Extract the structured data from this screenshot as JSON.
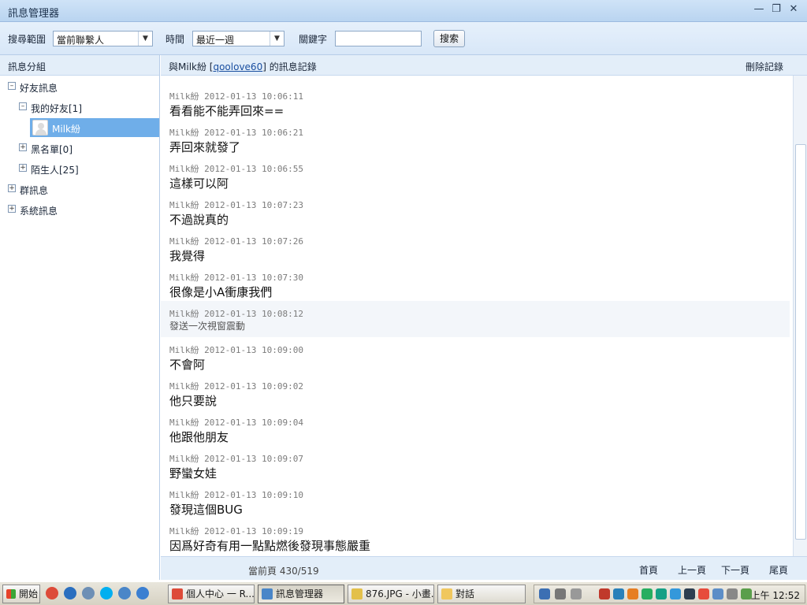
{
  "window": {
    "title": "訊息管理器"
  },
  "toolbar": {
    "scope_label": "搜尋範圍",
    "scope_value": "當前聯繫人",
    "time_label": "時間",
    "time_value": "最近一週",
    "keyword_label": "關鍵字",
    "keyword_value": "",
    "search_button": "搜索"
  },
  "left": {
    "header": "訊息分組",
    "tree": {
      "friend_msgs": "好友訊息",
      "my_friends": "我的好友[1]",
      "contact": "Milk紛",
      "blacklist": "黑名單[0]",
      "strangers": "陌生人[25]",
      "group_msgs": "群訊息",
      "system_msgs": "系統訊息"
    }
  },
  "right": {
    "header_prefix": "與Milk紛 [",
    "header_link": "qoolove60",
    "header_suffix": "] 的訊息記錄",
    "delete": "刪除記錄"
  },
  "messages": [
    {
      "meta": "Milk紛 2012-01-13 10:06:11",
      "text": "看看能不能弄回來=="
    },
    {
      "meta": "Milk紛 2012-01-13 10:06:21",
      "text": "弄回來就發了"
    },
    {
      "meta": "Milk紛 2012-01-13 10:06:55",
      "text": "這樣可以阿"
    },
    {
      "meta": "Milk紛 2012-01-13 10:07:23",
      "text": "不過說真的"
    },
    {
      "meta": "Milk紛 2012-01-13 10:07:26",
      "text": "我覺得"
    },
    {
      "meta": "Milk紛 2012-01-13 10:07:30",
      "text": "很像是小A衝康我們"
    },
    {
      "meta": "Milk紛 2012-01-13 10:08:12",
      "text": "發送一次視窗震動"
    },
    {
      "meta": "Milk紛 2012-01-13 10:09:00",
      "text": "不會阿"
    },
    {
      "meta": "Milk紛 2012-01-13 10:09:02",
      "text": "他只要說"
    },
    {
      "meta": "Milk紛 2012-01-13 10:09:04",
      "text": "他跟他朋友"
    },
    {
      "meta": "Milk紛 2012-01-13 10:09:07",
      "text": "野蠻女娃"
    },
    {
      "meta": "Milk紛 2012-01-13 10:09:10",
      "text": "發現這個BUG"
    },
    {
      "meta": "Milk紛 2012-01-13 10:09:19",
      "text": "因爲好奇有用一點點燃後發現事態嚴重"
    }
  ],
  "pager": {
    "status": "當前頁 430/519",
    "first": "首頁",
    "prev": "上一頁",
    "next": "下一頁",
    "last": "尾頁"
  },
  "taskbar": {
    "start": "開始",
    "tasks": [
      "個人中心 一 R...",
      "訊息管理器",
      "876.JPG - 小畫...",
      "對話"
    ],
    "clock": "上午 12:52"
  }
}
